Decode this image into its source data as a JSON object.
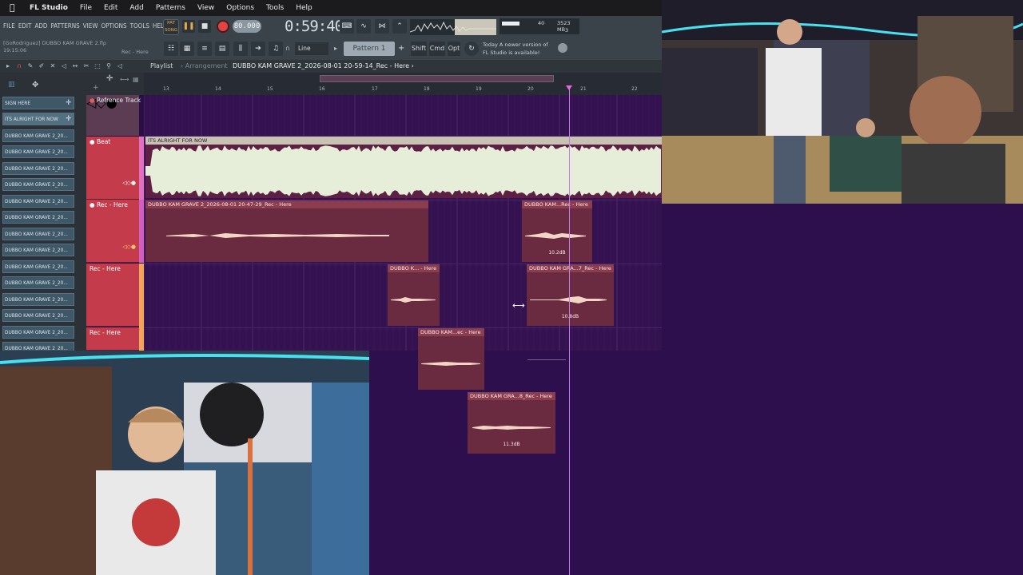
{
  "macos": {
    "app_name": "FL Studio",
    "menu": [
      "File",
      "Edit",
      "Add",
      "Patterns",
      "View",
      "Options",
      "Tools",
      "Help"
    ]
  },
  "toolbar": {
    "fl_menu": [
      "FILE",
      "EDIT",
      "ADD",
      "PATTERNS",
      "VIEW",
      "OPTIONS",
      "TOOLS",
      "HELP"
    ],
    "project_hint": "[GoRodriguez] DUBBO KAM GRAVE 2.flp",
    "time_hint": "19:15:06",
    "rec_hint": "Rec - Here",
    "song_mode": "SONG",
    "pat_mode": "PAT",
    "tempo": "80.000",
    "time": "0:59:40",
    "cpu_value": "40",
    "mem_value": "3523 MB",
    "voices": "3",
    "snap": "Line",
    "pattern": "Pattern 1",
    "shift": "Shift",
    "cmd": "Cmd",
    "opt": "Opt",
    "news_line1": "Today  A newer version of",
    "news_line2": "FL Studio is available!"
  },
  "playlist": {
    "title": "Playlist",
    "separator": "›",
    "view": "Arrangement",
    "current": "DUBBO KAM GRAVE 2_2026-08-01 20-59-14_Rec - Here",
    "current_arrow": "›",
    "ruler_ticks": [
      "13",
      "14",
      "15",
      "16",
      "17",
      "18",
      "19",
      "20",
      "21",
      "22"
    ]
  },
  "picker": {
    "items": [
      "SIGN HERE",
      "ITS ALRIGHT FOR NOW",
      "DUBBO KAM GRAVE 2_20...",
      "DUBBO KAM GRAVE 2_20...",
      "DUBBO KAM GRAVE 2_20...",
      "DUBBO KAM GRAVE 2_20...",
      "DUBBO KAM GRAVE 2_20...",
      "DUBBO KAM GRAVE 2_20...",
      "DUBBO KAM GRAVE 2_20...",
      "DUBBO KAM GRAVE 2_20...",
      "DUBBO KAM GRAVE 2_20...",
      "DUBBO KAM GRAVE 2_20...",
      "DUBBO KAM GRAVE 2_20...",
      "DUBBO KAM GRAVE 2_20...",
      "DUBBO KAM GRAVE 2_20...",
      "DUBBO KAM GRAVE 2_20..."
    ]
  },
  "tracks": [
    {
      "name": "Refrence Track"
    },
    {
      "name": "Beat"
    },
    {
      "name": "Rec - Here"
    },
    {
      "name": "Rec - Here"
    },
    {
      "name": "Rec - Here"
    }
  ],
  "clips": {
    "beat": "ITS ALRIGHT FOR NOW",
    "rec_main": "DUBBO KAM GRAVE 2_2026-08-01 20-47-29_Rec - Here",
    "rec_a": "DUBBO KAM...Rec - Here",
    "rec_a_db": "10.2dB",
    "rec_b": "DUBBO K... - Here",
    "rec_c": "DUBBO KAM GRA...7_Rec - Here",
    "rec_c_db": "10.8dB",
    "rec_d": "DUBBO KAM...ec - Here",
    "rec_e": "DUBBO KAM GRA...8_Rec - Here",
    "rec_e_db": "11.3dB"
  },
  "colors": {
    "record": "#e24444",
    "track_header": "#c43c4b",
    "arrangement_bg": "#34114f",
    "beat_clip_header": "#c7c2b2",
    "playhead": "#c27cf0"
  }
}
